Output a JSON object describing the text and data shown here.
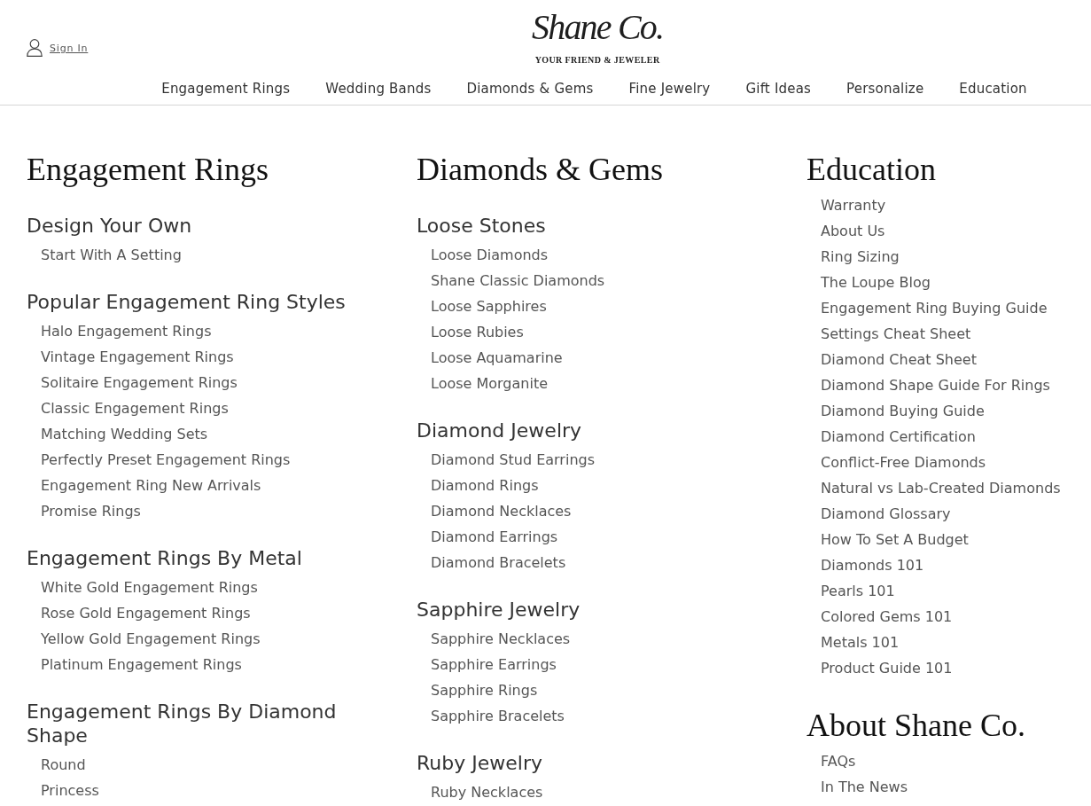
{
  "header": {
    "sign_in": "Sign In",
    "logo": {
      "wordmark": "Shane Co.",
      "tagline": "YOUR FRIEND & JEWELER"
    }
  },
  "nav": [
    "Engagement Rings",
    "Wedding Bands",
    "Diamonds & Gems",
    "Fine Jewelry",
    "Gift Ideas",
    "Personalize",
    "Education"
  ],
  "columns": [
    {
      "blocks": [
        {
          "kind": "title",
          "text": "Engagement Rings"
        },
        {
          "kind": "group",
          "title": "Design Your Own",
          "links": [
            "Start With A Setting"
          ]
        },
        {
          "kind": "group",
          "title": "Popular Engagement Ring Styles",
          "links": [
            "Halo Engagement Rings",
            "Vintage Engagement Rings",
            "Solitaire Engagement Rings",
            "Classic Engagement Rings",
            "Matching Wedding Sets",
            "Perfectly Preset Engagement Rings",
            "Engagement Ring New Arrivals",
            "Promise Rings"
          ]
        },
        {
          "kind": "group",
          "title": "Engagement Rings By Metal",
          "links": [
            "White Gold Engagement Rings",
            "Rose Gold Engagement Rings",
            "Yellow Gold Engagement Rings",
            "Platinum Engagement Rings"
          ]
        },
        {
          "kind": "group",
          "title": "Engagement Rings By Diamond Shape",
          "links": [
            "Round",
            "Princess"
          ]
        }
      ]
    },
    {
      "blocks": [
        {
          "kind": "title",
          "text": "Diamonds & Gems"
        },
        {
          "kind": "group",
          "title": "Loose Stones",
          "links": [
            "Loose Diamonds",
            "Shane Classic Diamonds",
            "Loose Sapphires",
            "Loose Rubies",
            "Loose Aquamarine",
            "Loose Morganite"
          ]
        },
        {
          "kind": "group",
          "title": "Diamond Jewelry",
          "links": [
            "Diamond Stud Earrings",
            "Diamond Rings",
            "Diamond Necklaces",
            "Diamond Earrings",
            "Diamond Bracelets"
          ]
        },
        {
          "kind": "group",
          "title": "Sapphire Jewelry",
          "links": [
            "Sapphire Necklaces",
            "Sapphire Earrings",
            "Sapphire Rings",
            "Sapphire Bracelets"
          ]
        },
        {
          "kind": "group",
          "title": "Ruby Jewelry",
          "links": [
            "Ruby Necklaces"
          ]
        }
      ]
    },
    {
      "blocks": [
        {
          "kind": "title",
          "text": "Education"
        },
        {
          "kind": "group",
          "links": [
            "Warranty",
            "About Us",
            "Ring Sizing",
            "The Loupe Blog",
            "Engagement Ring Buying Guide",
            "Settings Cheat Sheet",
            "Diamond Cheat Sheet",
            "Diamond Shape Guide For Rings",
            "Diamond Buying Guide",
            "Diamond Certification",
            "Conflict-Free Diamonds",
            "Natural vs Lab-Created Diamonds",
            "Diamond Glossary",
            "How To Set A Budget",
            "Diamonds 101",
            "Pearls 101",
            "Colored Gems 101",
            "Metals 101",
            "Product Guide 101"
          ]
        },
        {
          "kind": "title",
          "text": "About Shane Co."
        },
        {
          "kind": "group",
          "links": [
            "FAQs",
            "In The News"
          ]
        }
      ]
    }
  ]
}
